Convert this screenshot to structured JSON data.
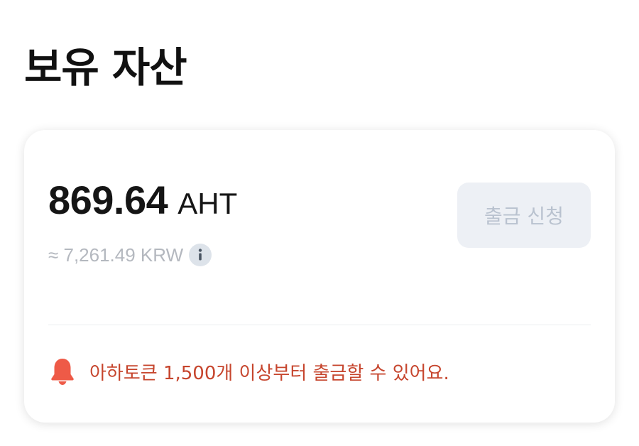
{
  "page": {
    "title": "보유 자산"
  },
  "balance": {
    "amount": "869.64",
    "unit": "AHT",
    "krw_equivalent": "≈ 7,261.49 KRW"
  },
  "actions": {
    "withdraw_label": "출금 신청"
  },
  "notice": {
    "text": "아하토큰 1,500개 이상부터 출금할 수 있어요.",
    "icon": "bell-icon"
  },
  "colors": {
    "notice_red": "#c6452d",
    "bell": "#ee5a47",
    "button_bg_disabled": "#edf0f5",
    "button_text_disabled": "#b9c2cf",
    "muted_text": "#b4b8bf"
  }
}
